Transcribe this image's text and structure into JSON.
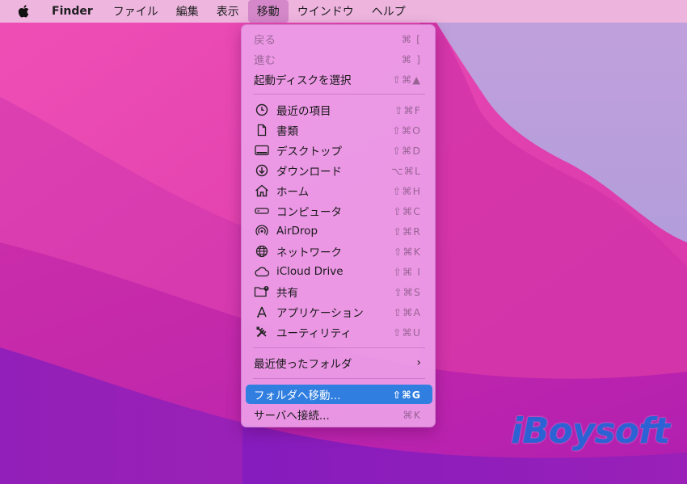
{
  "menubar": {
    "apple_icon": "apple-logo-icon",
    "items": [
      {
        "label": "Finder"
      },
      {
        "label": "ファイル"
      },
      {
        "label": "編集"
      },
      {
        "label": "表示"
      },
      {
        "label": "移動"
      },
      {
        "label": "ウインドウ"
      },
      {
        "label": "ヘルプ"
      }
    ],
    "active_index": 4
  },
  "go_menu": {
    "items": [
      {
        "label": "戻る",
        "shortcut": "⌘ [",
        "enabled": false
      },
      {
        "label": "進む",
        "shortcut": "⌘ ]",
        "enabled": false
      },
      {
        "label": "起動ディスクを選択",
        "shortcut": "⇧⌘▲",
        "enabled": true
      },
      {
        "label": "最近の項目",
        "shortcut": "⇧⌘F",
        "icon": "clock-icon"
      },
      {
        "label": "書類",
        "shortcut": "⇧⌘O",
        "icon": "document-icon"
      },
      {
        "label": "デスクトップ",
        "shortcut": "⇧⌘D",
        "icon": "desktop-icon"
      },
      {
        "label": "ダウンロード",
        "shortcut": "⌥⌘L",
        "icon": "download-icon"
      },
      {
        "label": "ホーム",
        "shortcut": "⇧⌘H",
        "icon": "home-icon"
      },
      {
        "label": "コンピュータ",
        "shortcut": "⇧⌘C",
        "icon": "computer-icon"
      },
      {
        "label": "AirDrop",
        "shortcut": "⇧⌘R",
        "icon": "airdrop-icon"
      },
      {
        "label": "ネットワーク",
        "shortcut": "⇧⌘K",
        "icon": "network-icon"
      },
      {
        "label": "iCloud Drive",
        "shortcut": "⇧⌘ I",
        "icon": "cloud-icon"
      },
      {
        "label": "共有",
        "shortcut": "⇧⌘S",
        "icon": "shared-folder-icon"
      },
      {
        "label": "アプリケーション",
        "shortcut": "⇧⌘A",
        "icon": "applications-icon"
      },
      {
        "label": "ユーティリティ",
        "shortcut": "⇧⌘U",
        "icon": "utilities-icon"
      },
      {
        "label": "最近使ったフォルダ",
        "submenu": true
      },
      {
        "label": "フォルダへ移動...",
        "shortcut": "⇧⌘G",
        "selected": true
      },
      {
        "label": "サーバへ接続...",
        "shortcut": "⌘K"
      }
    ]
  },
  "watermark": {
    "text": "iBoysoft"
  },
  "colors": {
    "selection": "#2f7ee0",
    "menu_bg": "#ec9ee8",
    "wallpaper_main": "#c72aa9",
    "watermark": "#2c62d4"
  }
}
